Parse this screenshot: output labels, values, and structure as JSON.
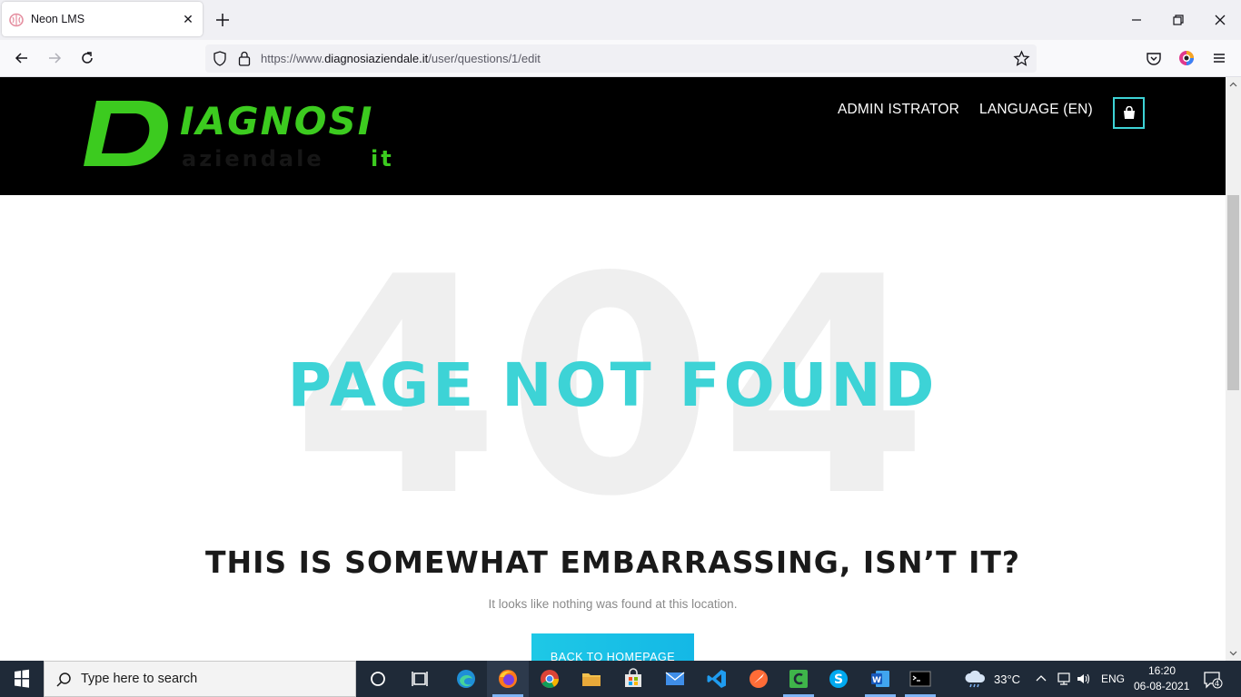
{
  "browser": {
    "tab_title": "Neon LMS",
    "url_prefix": "https://www.",
    "url_host": "diagnosiaziendale.it",
    "url_path": "/user/questions/1/edit"
  },
  "site": {
    "logo_brand": "IAGNOSI",
    "logo_sub": "aziendale",
    "logo_tld": "it",
    "menu": [
      "ADMIN ISTRATOR",
      "LANGUAGE (EN)"
    ]
  },
  "error": {
    "code": "404",
    "title": "PAGE NOT FOUND",
    "heading": "THIS IS SOMEWHAT EMBARRASSING, ISN’T IT?",
    "message": "It looks like nothing was found at this location.",
    "button": "BACK TO HOMEPAGE"
  },
  "taskbar": {
    "search_placeholder": "Type here to search",
    "weather": "33°C",
    "language": "ENG",
    "time": "16:20",
    "date": "06-08-2021",
    "notifications": "4"
  },
  "colors": {
    "accent": "#3dd3d6",
    "logo_green": "#3ccb1f",
    "header_bg": "#000000",
    "button": "#14b8e6"
  }
}
